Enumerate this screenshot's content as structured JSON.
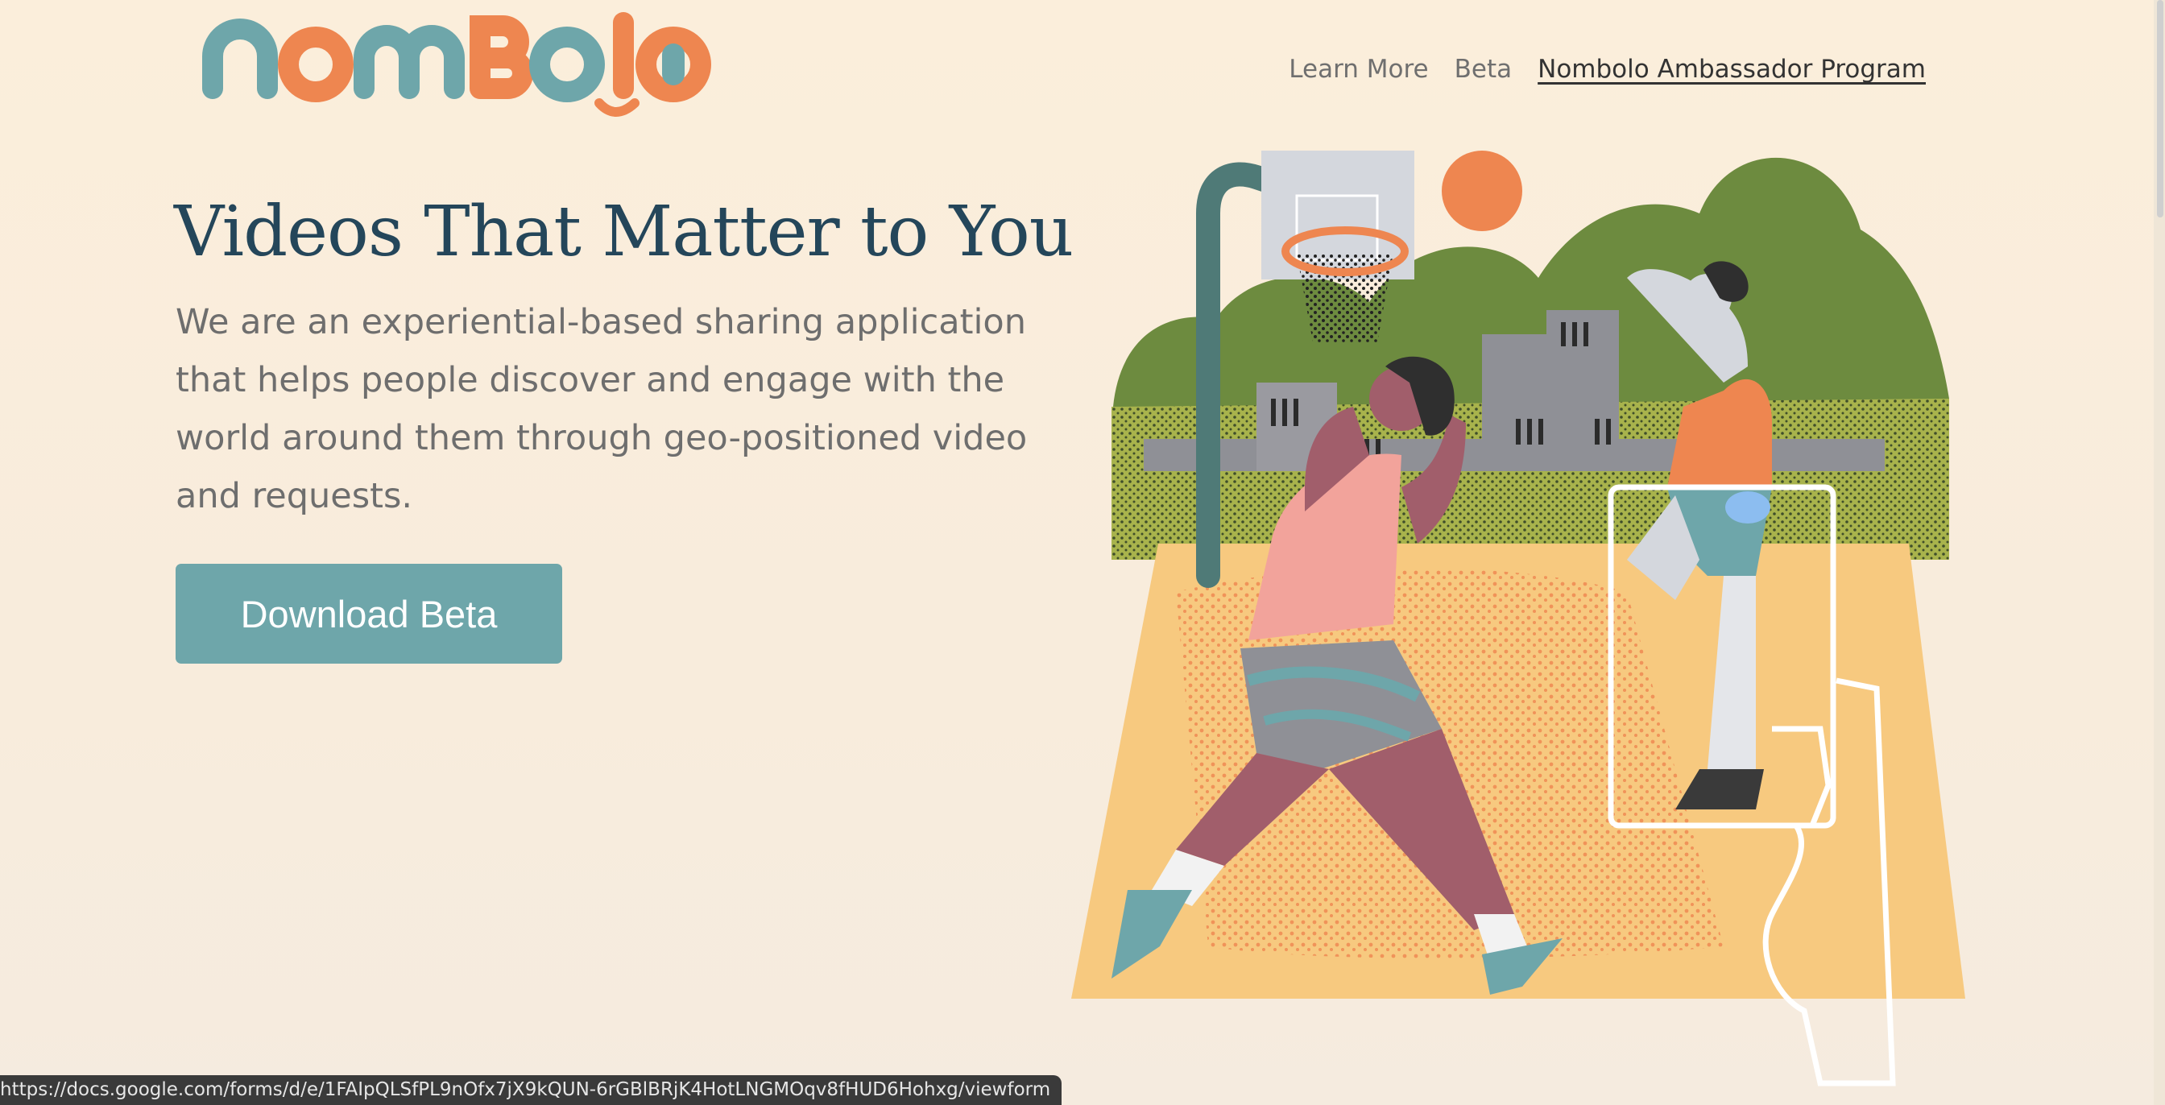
{
  "brand": {
    "name": "nombolo",
    "colors": {
      "teal": "#6ea6aa",
      "orange": "#ee8650",
      "navy": "#24465a"
    }
  },
  "nav": {
    "items": [
      {
        "label": "Learn More"
      },
      {
        "label": "Beta"
      },
      {
        "label": "Nombolo Ambassador Program"
      }
    ]
  },
  "hero": {
    "title": "Videos That Matter to You",
    "description": "We are an experiential-based sharing application that helps people discover and engage with the world around them through geo-positioned video and requests.",
    "cta_label": "Download Beta"
  },
  "illustration": {
    "icon": "basketball-players-illustration"
  },
  "status_bar": {
    "url": "https://docs.google.com/forms/d/e/1FAIpQLSfPL9nOfx7jX9kQUN-6rGBlBRjK4HotLNGMOqv8fHUD6Hohxg/viewform"
  }
}
